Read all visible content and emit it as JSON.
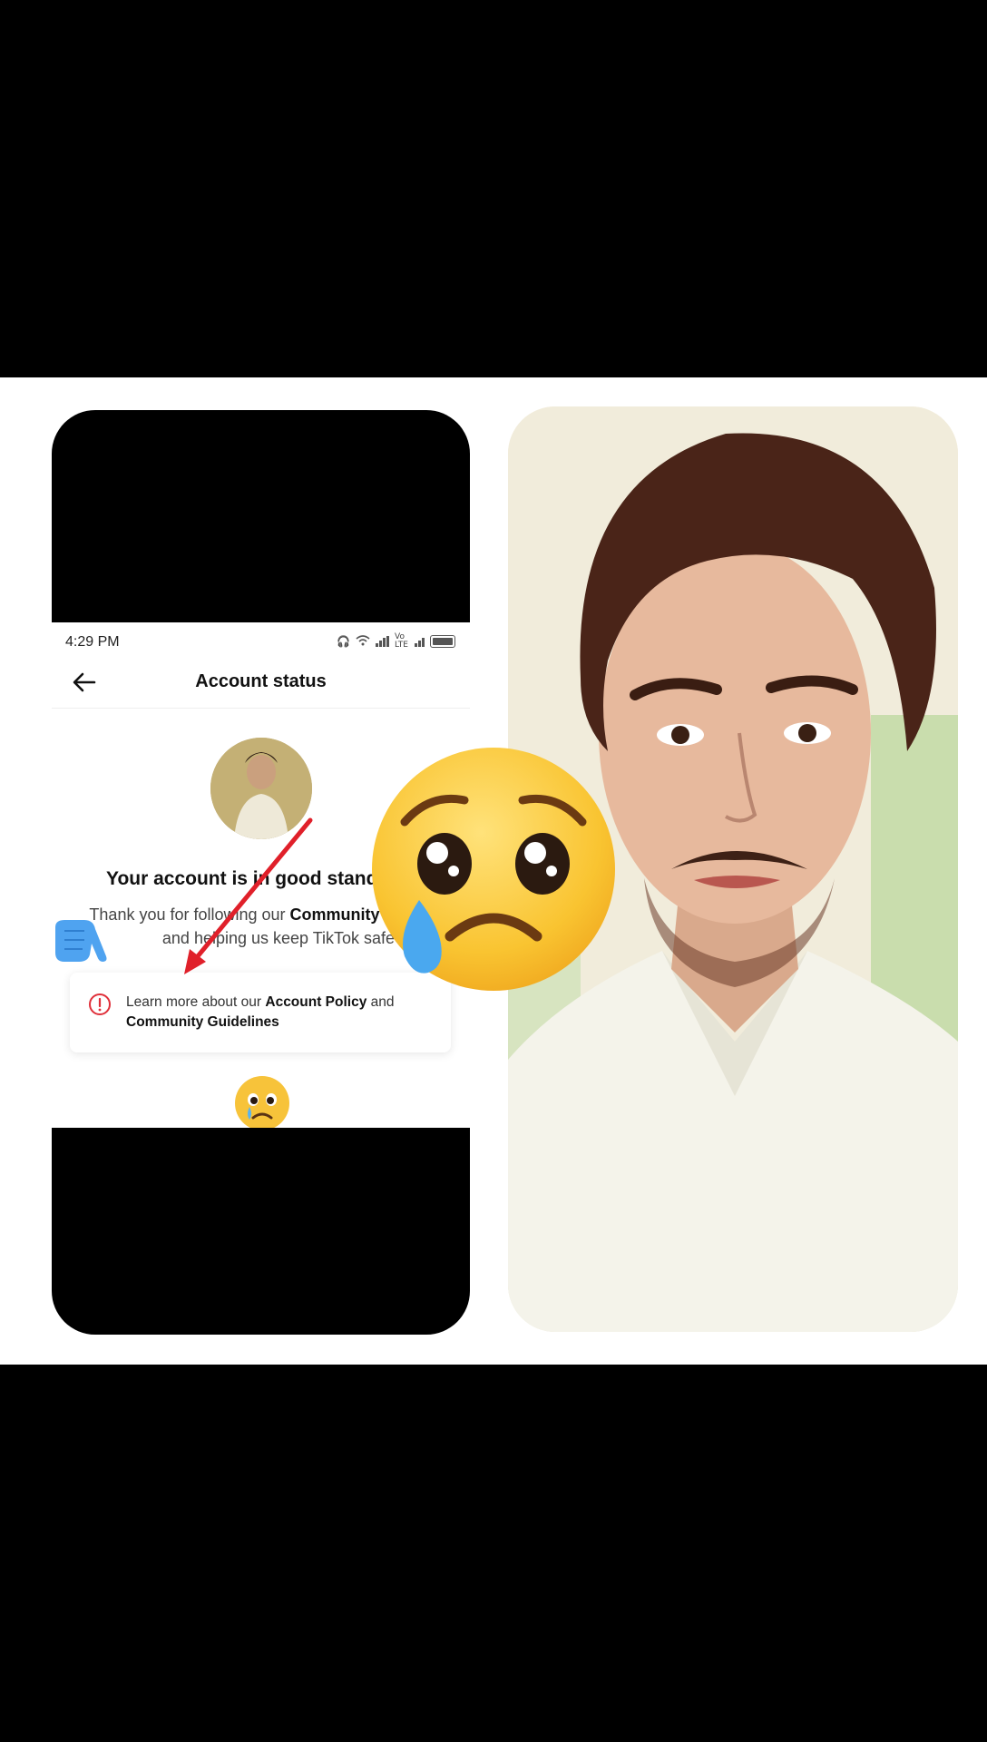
{
  "phone": {
    "status_time": "4:29 PM",
    "status_network": "Vo LTE",
    "nav_title": "Account status",
    "headline": "Your account is in good standing",
    "body_prefix": "Thank you for following our ",
    "body_bold1": "Community Guidelines",
    "body_suffix": " and helping us keep TikTok safe",
    "info_prefix": "Learn more about our ",
    "info_bold1": "Account Policy",
    "info_mid": " and ",
    "info_bold2": "Community Guidelines"
  },
  "colors": {
    "background": "#000000",
    "panel": "#ffffff",
    "arrow": "#e0202a",
    "info_icon": "#e0303a",
    "emoji_face": "#f7c33a"
  },
  "icons": {
    "back": "back-arrow-icon",
    "info": "exclamation-circle-icon",
    "emoji": "sad-tear-face-emoji",
    "hand": "pointing-hand-emoji"
  }
}
